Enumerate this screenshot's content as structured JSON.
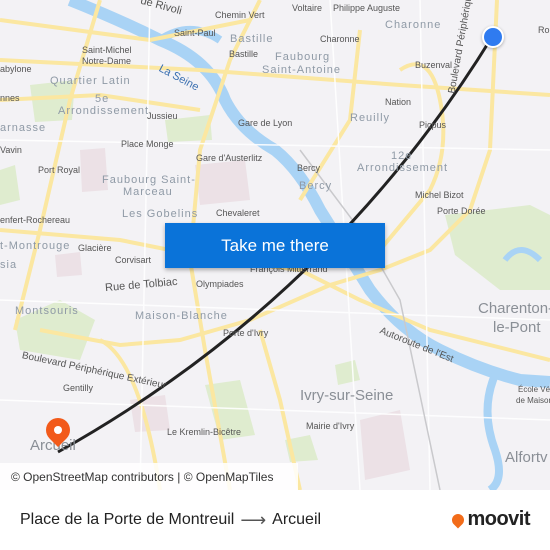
{
  "map": {
    "labels": [
      "de Rivoli",
      "Chemin Vert",
      "Voltaire",
      "Philippe Auguste",
      "Saint-Paul",
      "Bastille",
      "Charonne",
      "Saint-Michel",
      "Notre-Dame",
      "Buzenval",
      "abylone",
      "nnes",
      "Jussieu",
      "Nation",
      "Gare de Lyon",
      "Picpus",
      "Vavin",
      "Place Monge",
      "Gare d'Austerlitz",
      "Bercy",
      "Port Royal",
      "Michel Bizot",
      "Chevaleret",
      "Porte Dorée",
      "enfert-Rochereau",
      "Glacière",
      "Corvisart",
      "François Mitterrand",
      "Olympiades",
      "Porte d'Ivry",
      "Gentilly",
      "Le Kremlin-Bicêtre",
      "Mairie d'Ivry",
      "École Vétérinaire",
      "de Maisons",
      "La Seine",
      "Rue de Tolbiac",
      "Boulevard Périphérique Extérieur",
      "Autoroute de l'Est",
      "Boulevard Périphérique Intérieur",
      "Ro"
    ],
    "districts": [
      "Bastille",
      "Charonne",
      "Faubourg",
      "Saint-Antoine",
      "Quartier Latin",
      "5e",
      "Arrondissement",
      "Reuilly",
      "arnasse",
      "12e",
      "Arrondissement",
      "Bercy",
      "Faubourg Saint-",
      "Marceau",
      "Les Gobelins",
      "t-Montrouge",
      "sia",
      "Montsouris",
      "Maison-Blanche"
    ],
    "cities": [
      "Charenton-",
      "le-Pont",
      "Ivry-sur-Seine",
      "Alfortv",
      "Arcueil"
    ],
    "origin_marker_color": "#2f7bf0",
    "destination_marker_color": "#f25a1a",
    "route_color": "#222222"
  },
  "cta": {
    "label": "Take me there",
    "color": "#0a73d9"
  },
  "attribution": "© OpenStreetMap contributors | © OpenMapTiles",
  "footer": {
    "from": "Place de la Porte de Montreuil",
    "arrow_icon": "arrow-right-icon",
    "to": "Arcueil",
    "logo": "moovit",
    "logo_color": "#f26c1a"
  }
}
